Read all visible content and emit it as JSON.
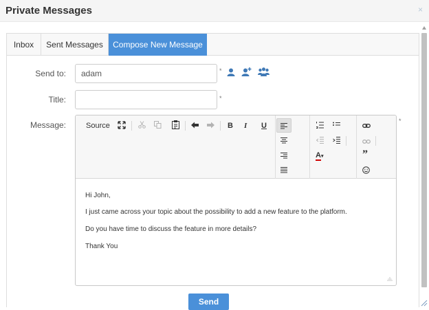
{
  "dialog": {
    "title": "Private Messages",
    "close_glyph": "×"
  },
  "tabs": [
    {
      "label": "Inbox",
      "active": false
    },
    {
      "label": "Sent Messages",
      "active": false
    },
    {
      "label": "Compose New Message",
      "active": true
    }
  ],
  "form": {
    "send_to": {
      "label": "Send to:",
      "value": "adam"
    },
    "title": {
      "label": "Title:",
      "value": ""
    },
    "message": {
      "label": "Message:"
    },
    "required_marker": "*",
    "recipient_icons": [
      "user-icon",
      "user-add-icon",
      "users-group-icon"
    ]
  },
  "toolbar": {
    "source_label": "Source",
    "bold": "B",
    "italic": "I",
    "underline": "U",
    "text_color": "A",
    "blockquote": "”"
  },
  "message_body": [
    "Hi John,",
    "I just came across your topic about the possibility to add a new feature to the platform.",
    "Do you have time to discuss the feature in more details?",
    "Thank You"
  ],
  "send_button": {
    "label": "Send"
  },
  "colors": {
    "accent": "#4a90d9",
    "header_bg": "#f5f5f5",
    "icon_blue": "#3f79b6",
    "text_color_underline": "#d00000"
  }
}
